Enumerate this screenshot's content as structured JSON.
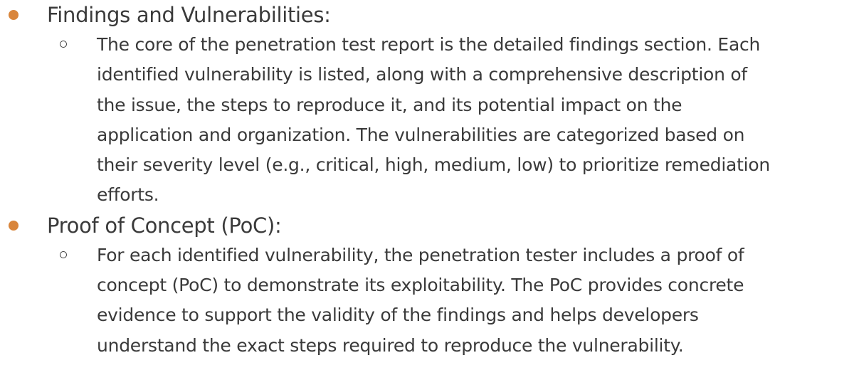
{
  "colors": {
    "bullet": "#d9853b",
    "text": "#3a3a3a"
  },
  "sections": [
    {
      "heading": "Findings and Vulnerabilities:",
      "paragraph_lines": [
        "The core of the penetration test report is the detailed findings section. Each",
        "identified vulnerability is listed, along with a comprehensive description of",
        "the issue, the steps to reproduce it, and its potential impact on the",
        "application and organization. The vulnerabilities are categorized based on",
        "their severity level (e.g., critical, high, medium, low) to prioritize remediation",
        "efforts."
      ]
    },
    {
      "heading": "Proof of Concept (PoC):",
      "paragraph_lines": [
        "For each identified vulnerability, the penetration tester includes a proof of",
        "concept (PoC) to demonstrate its exploitability. The PoC provides concrete",
        "evidence to support the validity of the findings and helps developers",
        "understand the exact steps required to reproduce the vulnerability."
      ]
    }
  ]
}
